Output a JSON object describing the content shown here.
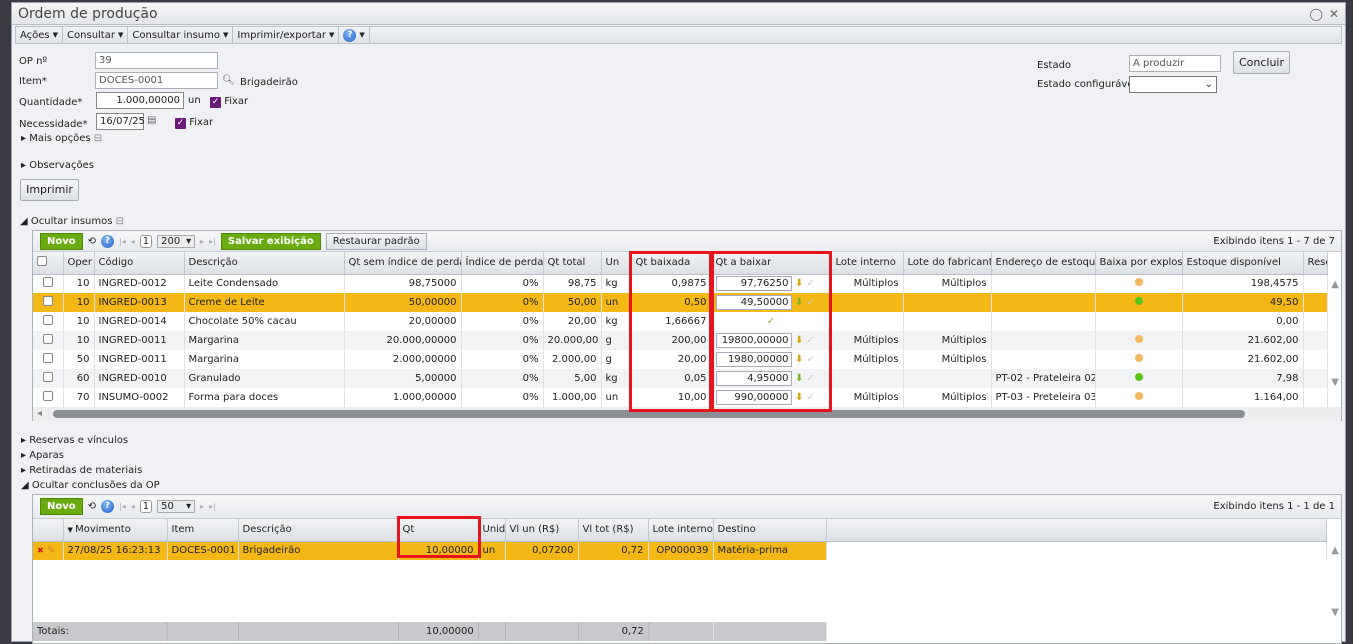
{
  "window": {
    "title": "Ordem de produção",
    "icons": [
      "comment-icon",
      "close-icon"
    ]
  },
  "menu": [
    {
      "label": "Ações"
    },
    {
      "label": "Consultar"
    },
    {
      "label": "Consultar insumo"
    },
    {
      "label": "Imprimir/exportar"
    }
  ],
  "form": {
    "op_label": "OP nº",
    "op_value": "39",
    "item_label": "Item*",
    "item_value": "DOCES-0001",
    "item_desc": "Brigadeirão",
    "qty_label": "Quantidade*",
    "qty_value": "1.000,00000",
    "qty_unit": "un",
    "fixar": "Fixar",
    "need_label": "Necessidade*",
    "need_value": "16/07/25",
    "more": "Mais opções",
    "obs": "Observações",
    "print": "Imprimir",
    "estado_label": "Estado",
    "estado_value": "A produzir",
    "estado_cfg_label": "Estado configurável",
    "estado_cfg_value": "",
    "concluir": "Concluir"
  },
  "insumos": {
    "section": "Ocultar insumos",
    "novo": "Novo",
    "page": "1",
    "page_size": "200",
    "save": "Salvar exibição",
    "restore": "Restaurar padrão",
    "info": "Exibindo itens 1 - 7 de 7",
    "columns": [
      "",
      "Oper",
      "Código",
      "Descrição",
      "Qt sem índice de perdas",
      "Índice de perdas",
      "Qt total",
      "Un",
      "Qt baixada",
      "Qt a baixar",
      "Lote interno",
      "Lote do fabricante",
      "Endereço de estoque",
      "Baixa por explosão",
      "Estoque disponível",
      "Rese"
    ],
    "rows": [
      {
        "oper": "10",
        "codigo": "INGRED-0012",
        "desc": "Leite Condensado",
        "qt_sem": "98,75000",
        "indice": "0%",
        "qt_total": "98,75",
        "un": "kg",
        "qt_baixada": "0,9875",
        "qt_a_baixar": "97,76250",
        "lote_int": "Múltiplos",
        "lote_fab": "Múltiplos",
        "endereco": "",
        "baixa": "orange",
        "estoque": "198,4575",
        "arrow": "yellow"
      },
      {
        "oper": "10",
        "codigo": "INGRED-0013",
        "desc": "Creme de Leite",
        "qt_sem": "50,00000",
        "indice": "0%",
        "qt_total": "50,00",
        "un": "un",
        "qt_baixada": "0,50",
        "qt_a_baixar": "49,50000",
        "lote_int": "",
        "lote_fab": "",
        "endereco": "",
        "baixa": "green",
        "estoque": "49,50",
        "arrow": "green",
        "selected": true
      },
      {
        "oper": "10",
        "codigo": "INGRED-0014",
        "desc": "Chocolate 50% cacau",
        "qt_sem": "20,00000",
        "indice": "0%",
        "qt_total": "20,00",
        "un": "kg",
        "qt_baixada": "1,66667",
        "qt_a_baixar": null,
        "lote_int": "",
        "lote_fab": "",
        "endereco": "",
        "baixa": "",
        "estoque": "0,00",
        "done": true
      },
      {
        "oper": "10",
        "codigo": "INGRED-0011",
        "desc": "Margarina",
        "qt_sem": "20.000,00000",
        "indice": "0%",
        "qt_total": "20.000,00",
        "un": "g",
        "qt_baixada": "200,00",
        "qt_a_baixar": "19800,00000",
        "lote_int": "Múltiplos",
        "lote_fab": "Múltiplos",
        "endereco": "",
        "baixa": "orange",
        "estoque": "21.602,00",
        "arrow": "yellow"
      },
      {
        "oper": "50",
        "codigo": "INGRED-0011",
        "desc": "Margarina",
        "qt_sem": "2.000,00000",
        "indice": "0%",
        "qt_total": "2.000,00",
        "un": "g",
        "qt_baixada": "20,00",
        "qt_a_baixar": "1980,00000",
        "lote_int": "Múltiplos",
        "lote_fab": "Múltiplos",
        "endereco": "",
        "baixa": "orange",
        "estoque": "21.602,00",
        "arrow": "yellow"
      },
      {
        "oper": "60",
        "codigo": "INGRED-0010",
        "desc": "Granulado",
        "qt_sem": "5,00000",
        "indice": "0%",
        "qt_total": "5,00",
        "un": "kg",
        "qt_baixada": "0,05",
        "qt_a_baixar": "4,95000",
        "lote_int": "",
        "lote_fab": "",
        "endereco": "PT-02 - Prateleira 02",
        "baixa": "green",
        "estoque": "7,98",
        "arrow": "green"
      },
      {
        "oper": "70",
        "codigo": "INSUMO-0002",
        "desc": "Forma para doces",
        "qt_sem": "1.000,00000",
        "indice": "0%",
        "qt_total": "1.000,00",
        "un": "un",
        "qt_baixada": "10,00",
        "qt_a_baixar": "990,00000",
        "lote_int": "Múltiplos",
        "lote_fab": "Múltiplos",
        "endereco": "PT-03 - Preteleira 03",
        "baixa": "orange",
        "estoque": "1.164,00",
        "arrow": "yellow"
      }
    ]
  },
  "sections": [
    "Reservas e vínculos",
    "Aparas",
    "Retiradas de materiais"
  ],
  "conclusoes": {
    "section": "Ocultar conclusões da OP",
    "novo": "Novo",
    "page": "1",
    "page_size": "50",
    "info": "Exibindo itens 1 - 1 de 1",
    "columns": [
      "",
      "Movimento",
      "Item",
      "Descrição",
      "Qt",
      "Unid",
      "Vl un (R$)",
      "Vl tot (R$)",
      "Lote interno",
      "Destino"
    ],
    "rows": [
      {
        "movimento": "27/08/25 16:23:13",
        "item": "DOCES-0001",
        "desc": "Brigadeirão",
        "qt": "10,00000",
        "unid": "un",
        "vl_un": "0,07200",
        "vl_tot": "0,72",
        "lote": "OP000039",
        "destino": "Matéria-prima"
      }
    ],
    "totals_label": "Totais:",
    "total_qt": "10,00000",
    "total_vl": "0,72"
  },
  "colors": {
    "highlight": "#f3b716",
    "accent_green": "#6aab11",
    "annotation_red": "#e8141c"
  }
}
